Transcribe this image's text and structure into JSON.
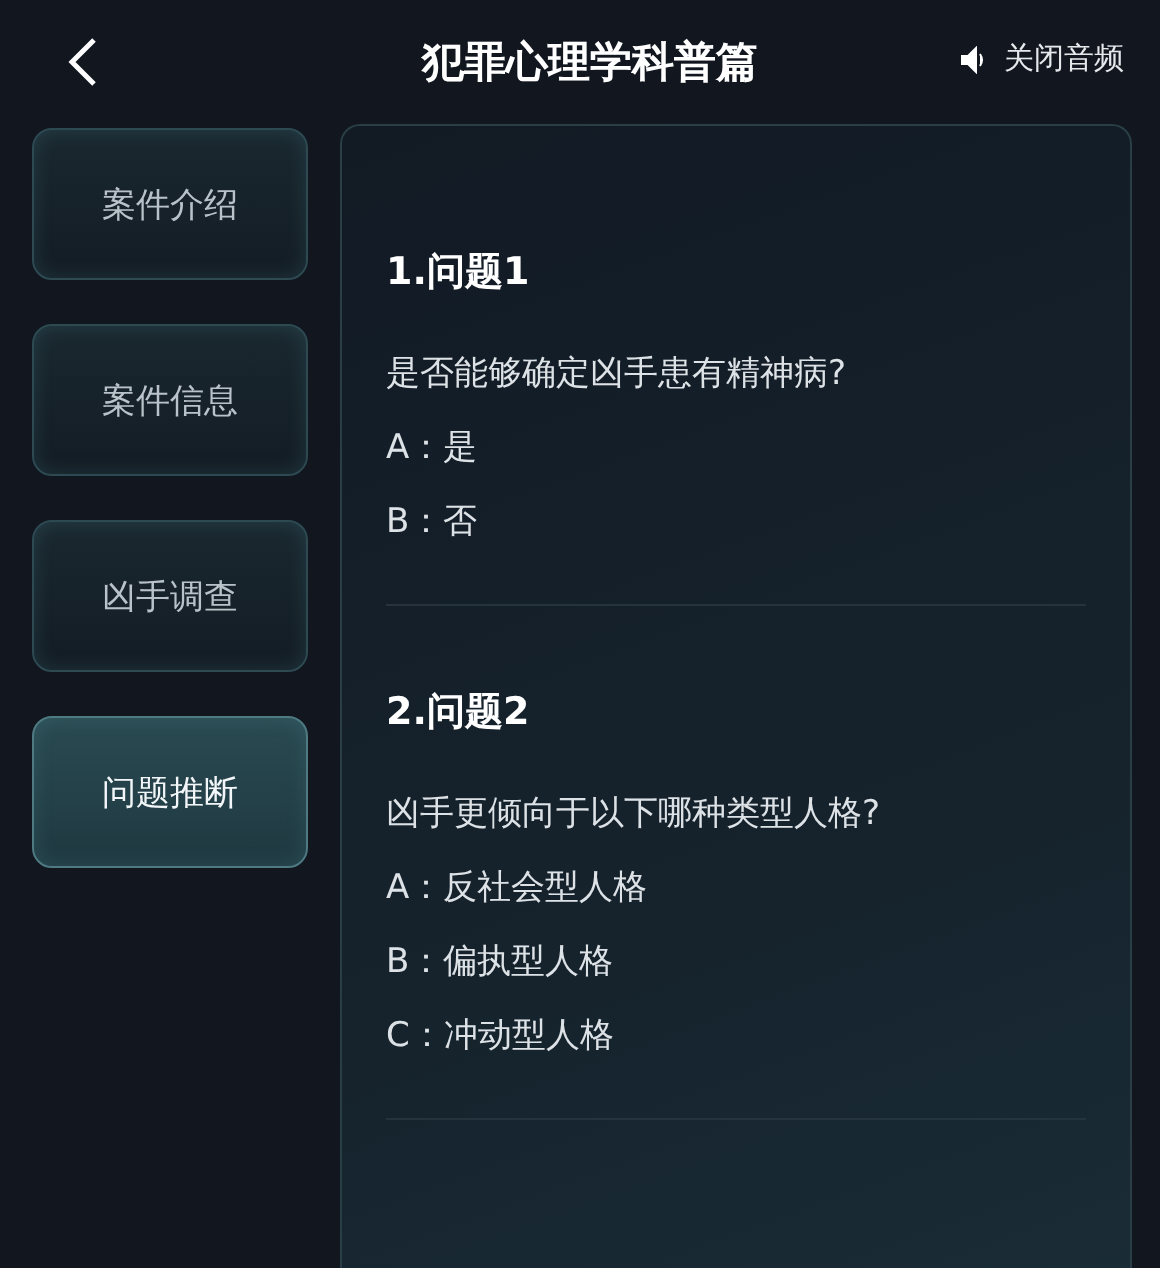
{
  "header": {
    "title": "犯罪心理学科普篇",
    "audio_toggle": "关闭音频"
  },
  "sidebar": {
    "items": [
      {
        "label": "案件介绍",
        "selected": false
      },
      {
        "label": "案件信息",
        "selected": false
      },
      {
        "label": "凶手调查",
        "selected": false
      },
      {
        "label": "问题推断",
        "selected": true
      }
    ]
  },
  "questions": [
    {
      "title": "1.问题1",
      "text": "是否能够确定凶手患有精神病?",
      "options": [
        "A：是",
        "B：否"
      ]
    },
    {
      "title": "2.问题2",
      "text": "凶手更倾向于以下哪种类型人格?",
      "options": [
        "A：反社会型人格",
        "B：偏执型人格",
        "C：冲动型人格"
      ]
    }
  ]
}
